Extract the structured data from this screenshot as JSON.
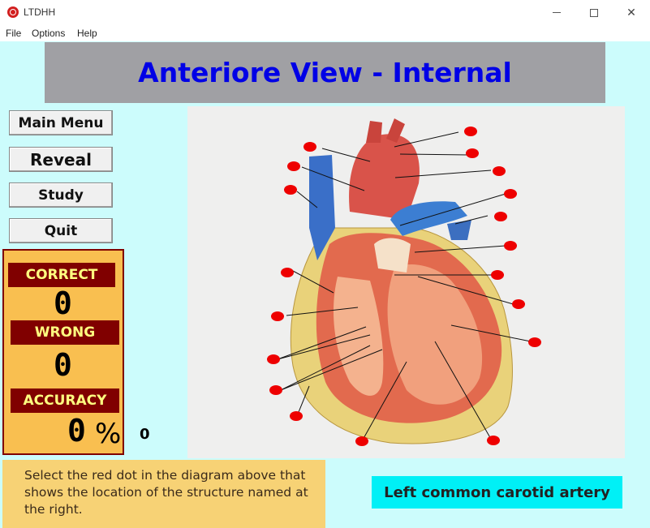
{
  "window": {
    "title": "LTDHH",
    "icon": "app-logo-icon"
  },
  "menu": {
    "items": [
      "File",
      "Options",
      "Help"
    ]
  },
  "header": {
    "title": "Anteriore View - Internal",
    "title_color": "#0000e6",
    "banner_color": "#a0a0a4"
  },
  "buttons": {
    "main_menu": "Main Menu",
    "reveal": "Reveal",
    "study": "Study",
    "quit": "Quit"
  },
  "score": {
    "correct_label": "CORRECT",
    "correct_value": "0",
    "wrong_label": "WRONG",
    "wrong_value": "0",
    "accuracy_label": "ACCURACY",
    "accuracy_value": "0",
    "accuracy_unit": "%",
    "side_count": "0"
  },
  "instruction": {
    "text": "Select the red dot  in the diagram above that shows the location of the structure named at the right."
  },
  "target": {
    "structure": "Left common carotid artery"
  },
  "colors": {
    "background": "#ccfcfc",
    "score_panel": "#f9bf50",
    "label_bg": "#800000",
    "label_text": "#ffff80",
    "instruction_bg": "#f7d275",
    "target_bg": "#00f0f6",
    "dot": "#ee0000"
  },
  "icons": {
    "minimize": "minimize-icon",
    "maximize": "maximize-icon",
    "close": "close-icon"
  },
  "diagram": {
    "label_dot_count": 21
  }
}
